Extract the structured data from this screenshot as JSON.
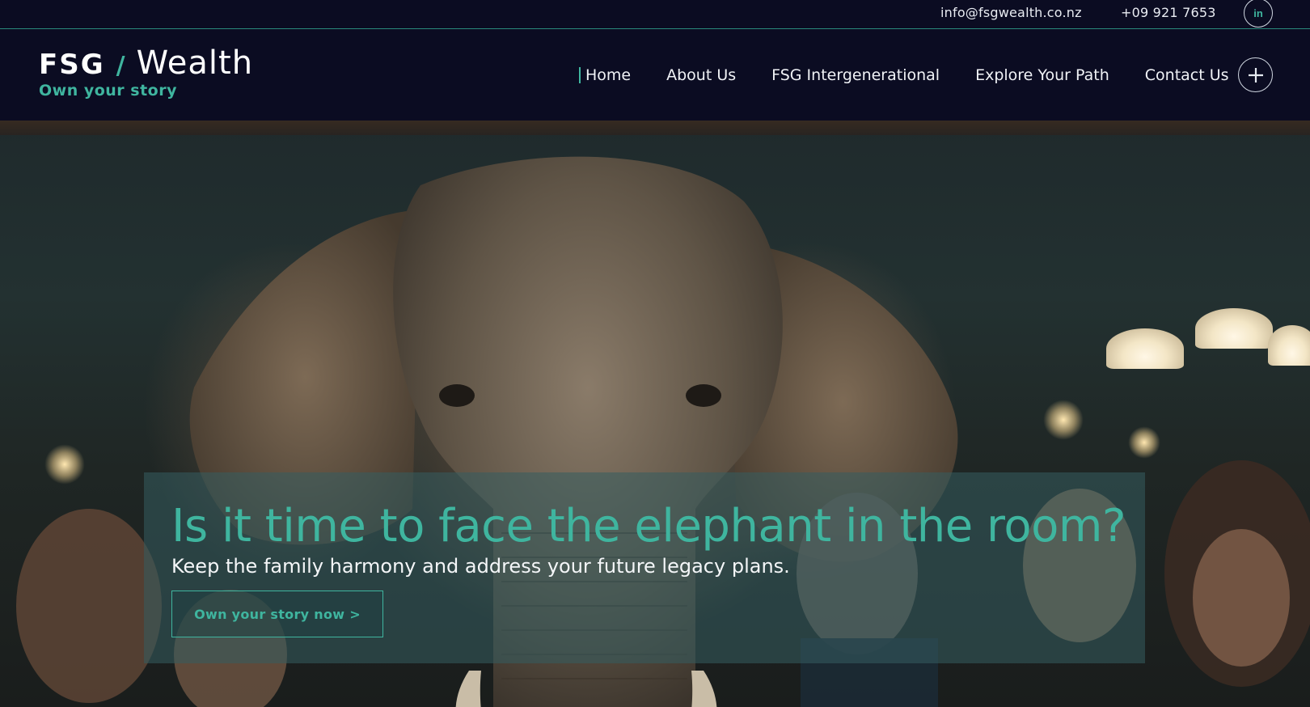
{
  "topbar": {
    "email": "info@fsgwealth.co.nz",
    "phone": "+09 921 7653",
    "linkedin_label": "in",
    "linkedin_icon": "linkedin-icon"
  },
  "logo": {
    "brand_short": "FSG",
    "slash": "/",
    "brand_word": "Wealth",
    "tagline": "Own your story"
  },
  "nav": {
    "items": [
      {
        "label": "Home",
        "active": true
      },
      {
        "label": "About Us"
      },
      {
        "label": "FSG Intergenerational"
      },
      {
        "label": "Explore Your Path"
      },
      {
        "label": "Contact Us"
      }
    ],
    "menu_icon": "plus-icon"
  },
  "hero": {
    "headline": "Is it time to face the elephant in the room?",
    "subhead": "Keep the family harmony and address your future legacy plans.",
    "cta_label": "Own your story now >"
  },
  "colors": {
    "background": "#0b0c22",
    "accent": "#3fb59f",
    "text": "#f0f2f6"
  }
}
